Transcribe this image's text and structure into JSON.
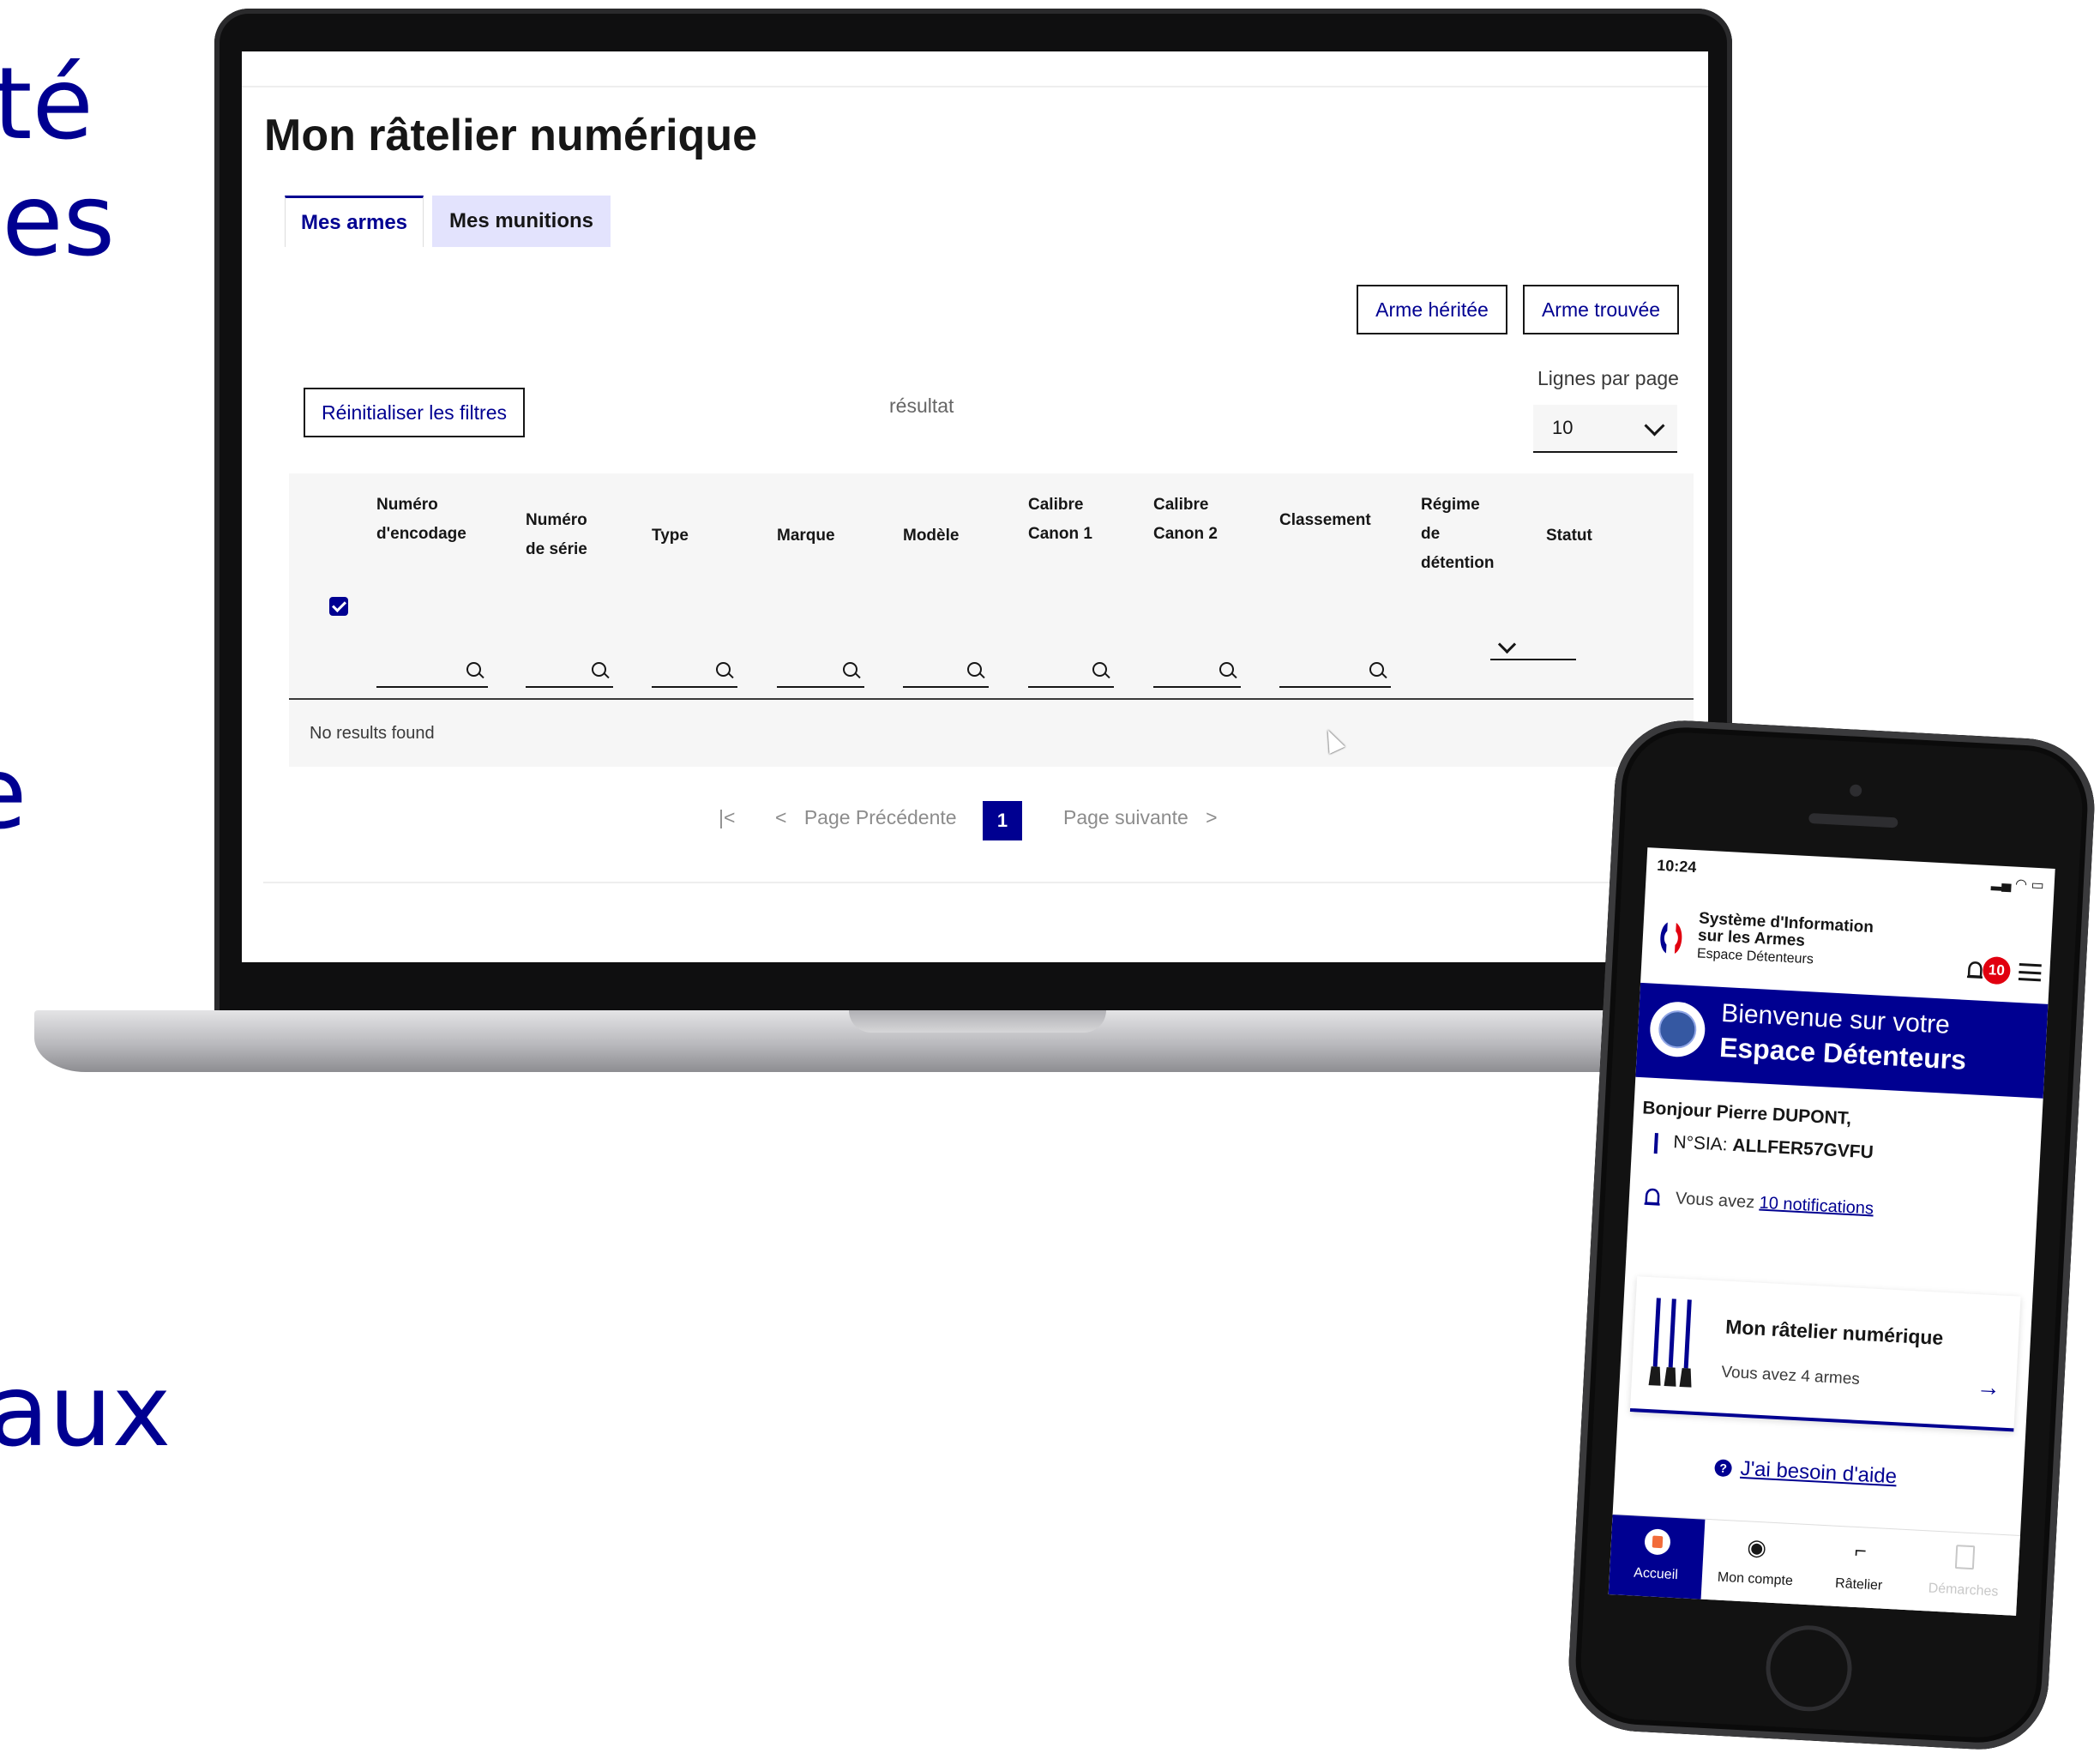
{
  "left_text": [
    "té",
    "les",
    "e",
    "aux"
  ],
  "laptop": {
    "page_title": "Mon râtelier numérique",
    "tabs": [
      {
        "label": "Mes armes",
        "active": true
      },
      {
        "label": "Mes munitions",
        "active": false
      }
    ],
    "buttons": {
      "arme_heritee": "Arme héritée",
      "arme_trouvee": "Arme trouvée",
      "reset_filters": "Réinitialiser les filtres"
    },
    "result_label": "résultat",
    "lines_per_page": {
      "label": "Lignes par page",
      "value": "10"
    },
    "table": {
      "select_all_checked": true,
      "columns": [
        {
          "label": "Numéro d'encodage",
          "lines": [
            "Numéro",
            "d'encodage"
          ]
        },
        {
          "label": "Numéro de série",
          "lines": [
            "Numéro",
            "de série"
          ]
        },
        {
          "label": "Type",
          "lines": [
            "Type"
          ]
        },
        {
          "label": "Marque",
          "lines": [
            "Marque"
          ]
        },
        {
          "label": "Modèle",
          "lines": [
            "Modèle"
          ]
        },
        {
          "label": "Calibre Canon 1",
          "lines": [
            "Calibre",
            "Canon 1"
          ]
        },
        {
          "label": "Calibre Canon 2",
          "lines": [
            "Calibre",
            "Canon 2"
          ]
        },
        {
          "label": "Classement",
          "lines": [
            "Classement"
          ]
        },
        {
          "label": "Régime de détention",
          "lines": [
            "Régime",
            "de",
            "détention"
          ]
        },
        {
          "label": "Statut",
          "lines": [
            "Statut"
          ]
        }
      ],
      "empty_message": "No results found"
    },
    "pagination": {
      "previous": "Page Précédente",
      "current": "1",
      "next": "Page suivante"
    },
    "colors": {
      "primary": "#000091",
      "tab_inactive": "#e3e3fd",
      "table_bg": "#f6f6f6"
    }
  },
  "phone": {
    "status_time": "10:24",
    "app_name_line1": "Système d'Information",
    "app_name_line2": "sur les Armes",
    "app_subtitle": "Espace Détenteurs",
    "notification_badge": "10",
    "banner_line1": "Bienvenue sur votre",
    "banner_line2": "Espace Détenteurs",
    "greeting": "Bonjour Pierre DUPONT,",
    "nsia_label": "N°SIA:",
    "nsia_value": "ALLFER57GVFU",
    "notif_prefix": "Vous avez",
    "notif_link": "10 notifications",
    "card_title": "Mon râtelier numérique",
    "card_subtitle": "Vous avez 4 armes",
    "help": "J'ai besoin d'aide",
    "bottom_nav": [
      {
        "label": "Accueil",
        "icon": "home-icon",
        "active": true
      },
      {
        "label": "Mon compte",
        "icon": "account-icon",
        "active": false
      },
      {
        "label": "Râtelier",
        "icon": "gun-icon",
        "active": false
      },
      {
        "label": "Démarches",
        "icon": "document-icon",
        "active": false
      }
    ],
    "colors": {
      "primary": "#000091",
      "badge": "#e1000f"
    }
  }
}
